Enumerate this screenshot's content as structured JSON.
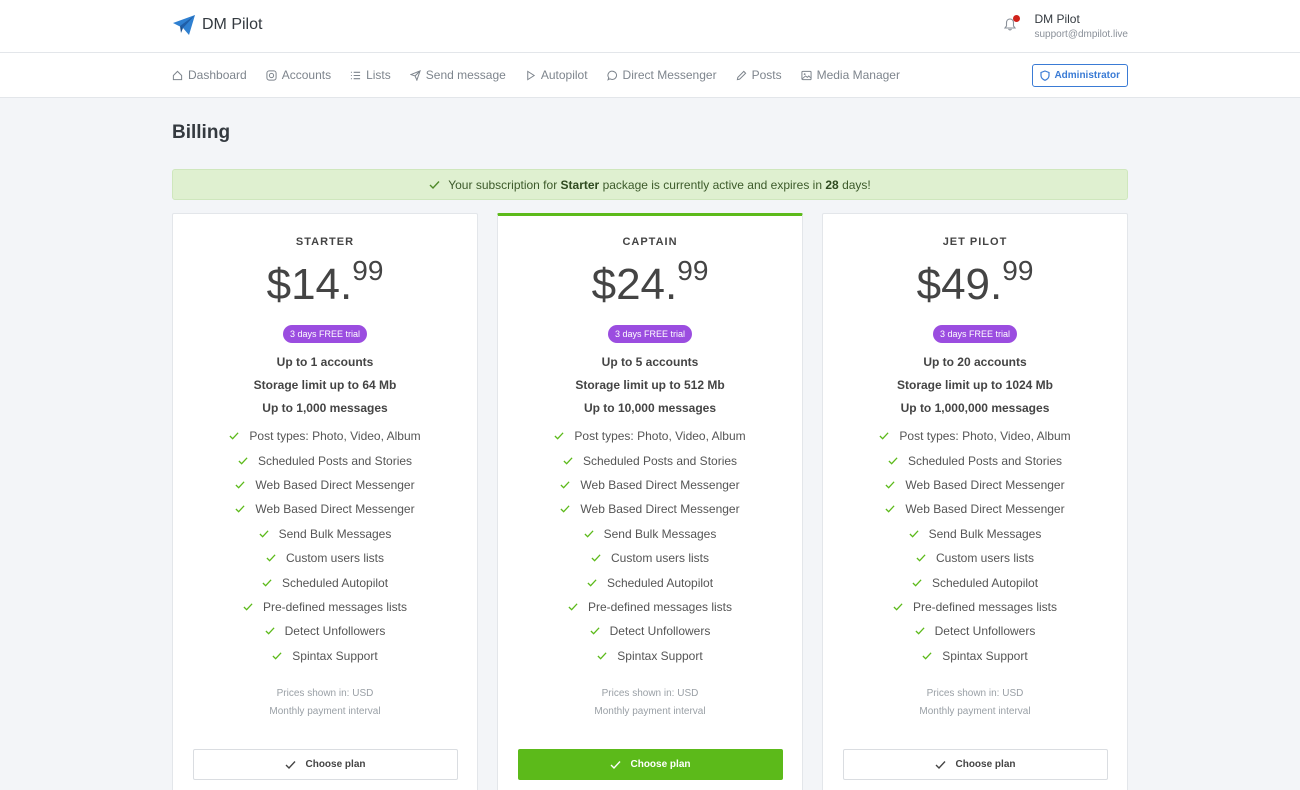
{
  "brand": {
    "name": "DM Pilot"
  },
  "user": {
    "name": "DM Pilot",
    "email": "support@dmpilot.live"
  },
  "nav": {
    "items": [
      {
        "label": "Dashboard",
        "icon": "home-icon"
      },
      {
        "label": "Accounts",
        "icon": "instagram-icon"
      },
      {
        "label": "Lists",
        "icon": "list-icon"
      },
      {
        "label": "Send message",
        "icon": "send-icon"
      },
      {
        "label": "Autopilot",
        "icon": "play-icon"
      },
      {
        "label": "Direct Messenger",
        "icon": "chat-icon"
      },
      {
        "label": "Posts",
        "icon": "pen-icon"
      },
      {
        "label": "Media Manager",
        "icon": "image-icon"
      }
    ],
    "admin_label": "Administrator"
  },
  "page": {
    "title": "Billing"
  },
  "alert": {
    "prefix": "Your subscription for",
    "package": "Starter",
    "middle": "package is currently active and expires in",
    "days": "28",
    "suffix": "days!"
  },
  "plans": [
    {
      "name": "STARTER",
      "currency": "$",
      "price_main": "14.",
      "price_cents": "99",
      "trial": "3 days FREE trial",
      "accounts": "Up to 1 accounts",
      "storage": "Storage limit up to 64 Mb",
      "messages": "Up to 1,000 messages",
      "features": [
        "Post types: Photo, Video, Album",
        "Scheduled Posts and Stories",
        "Web Based Direct Messenger",
        "Web Based Direct Messenger",
        "Send Bulk Messages",
        "Custom users lists",
        "Scheduled Autopilot",
        "Pre-defined messages lists",
        "Detect Unfollowers",
        "Spintax Support"
      ],
      "prices_shown": "Prices shown in: USD",
      "interval": "Monthly payment interval",
      "button": "Choose plan"
    },
    {
      "name": "CAPTAIN",
      "currency": "$",
      "price_main": "24.",
      "price_cents": "99",
      "trial": "3 days FREE trial",
      "accounts": "Up to 5 accounts",
      "storage": "Storage limit up to 512 Mb",
      "messages": "Up to 10,000 messages",
      "features": [
        "Post types: Photo, Video, Album",
        "Scheduled Posts and Stories",
        "Web Based Direct Messenger",
        "Web Based Direct Messenger",
        "Send Bulk Messages",
        "Custom users lists",
        "Scheduled Autopilot",
        "Pre-defined messages lists",
        "Detect Unfollowers",
        "Spintax Support"
      ],
      "prices_shown": "Prices shown in: USD",
      "interval": "Monthly payment interval",
      "button": "Choose plan"
    },
    {
      "name": "JET PILOT",
      "currency": "$",
      "price_main": "49.",
      "price_cents": "99",
      "trial": "3 days FREE trial",
      "accounts": "Up to 20 accounts",
      "storage": "Storage limit up to 1024 Mb",
      "messages": "Up to 1,000,000 messages",
      "features": [
        "Post types: Photo, Video, Album",
        "Scheduled Posts and Stories",
        "Web Based Direct Messenger",
        "Web Based Direct Messenger",
        "Send Bulk Messages",
        "Custom users lists",
        "Scheduled Autopilot",
        "Pre-defined messages lists",
        "Detect Unfollowers",
        "Spintax Support"
      ],
      "prices_shown": "Prices shown in: USD",
      "interval": "Monthly payment interval",
      "button": "Choose plan"
    }
  ],
  "colors": {
    "accent_green": "#5cba1a",
    "trial_purple": "#9b4de0",
    "admin_blue": "#3a7bd5",
    "alert_bg": "#dff0d0"
  }
}
